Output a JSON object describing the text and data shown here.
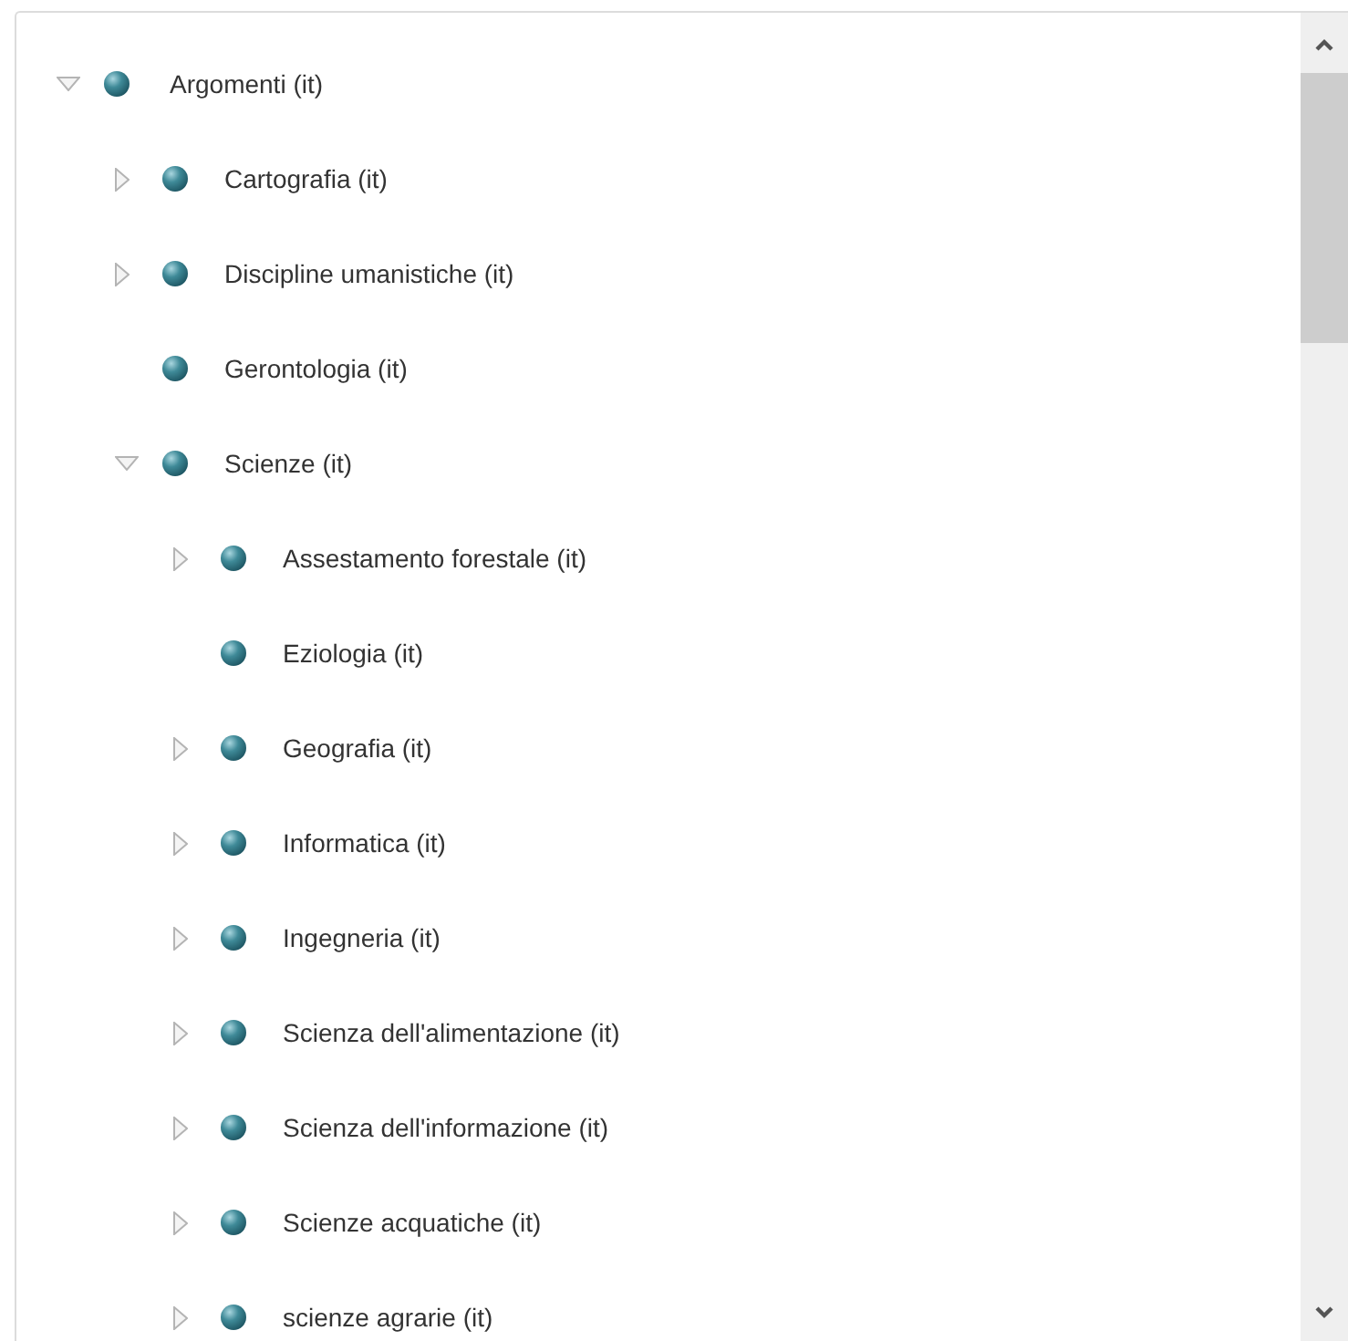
{
  "tree": [
    {
      "label": "Argomenti (it)",
      "kind": "branch",
      "expanded": true,
      "children": [
        {
          "label": "Cartografia (it)",
          "kind": "branch",
          "expanded": false
        },
        {
          "label": "Discipline umanistiche (it)",
          "kind": "branch",
          "expanded": false
        },
        {
          "label": "Gerontologia (it)",
          "kind": "leaf"
        },
        {
          "label": "Scienze (it)",
          "kind": "branch",
          "expanded": true,
          "children": [
            {
              "label": "Assestamento forestale (it)",
              "kind": "branch",
              "expanded": false
            },
            {
              "label": "Eziologia (it)",
              "kind": "leaf"
            },
            {
              "label": "Geografia (it)",
              "kind": "branch",
              "expanded": false
            },
            {
              "label": "Informatica (it)",
              "kind": "branch",
              "expanded": false
            },
            {
              "label": "Ingegneria (it)",
              "kind": "branch",
              "expanded": false
            },
            {
              "label": "Scienza dell'alimentazione (it)",
              "kind": "branch",
              "expanded": false
            },
            {
              "label": "Scienza dell'informazione (it)",
              "kind": "branch",
              "expanded": false
            },
            {
              "label": "Scienze acquatiche (it)",
              "kind": "branch",
              "expanded": false
            },
            {
              "label": "scienze agrarie (it)",
              "kind": "branch",
              "expanded": false
            }
          ]
        }
      ]
    }
  ]
}
